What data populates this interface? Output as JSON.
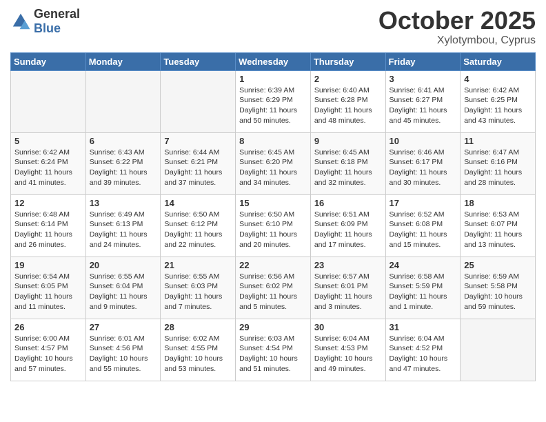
{
  "header": {
    "logo_general": "General",
    "logo_blue": "Blue",
    "month": "October 2025",
    "location": "Xylotymbou, Cyprus"
  },
  "days_of_week": [
    "Sunday",
    "Monday",
    "Tuesday",
    "Wednesday",
    "Thursday",
    "Friday",
    "Saturday"
  ],
  "weeks": [
    [
      {
        "day": "",
        "empty": true
      },
      {
        "day": "",
        "empty": true
      },
      {
        "day": "",
        "empty": true
      },
      {
        "day": "1",
        "sunrise": "Sunrise: 6:39 AM",
        "sunset": "Sunset: 6:29 PM",
        "daylight": "Daylight: 11 hours and 50 minutes."
      },
      {
        "day": "2",
        "sunrise": "Sunrise: 6:40 AM",
        "sunset": "Sunset: 6:28 PM",
        "daylight": "Daylight: 11 hours and 48 minutes."
      },
      {
        "day": "3",
        "sunrise": "Sunrise: 6:41 AM",
        "sunset": "Sunset: 6:27 PM",
        "daylight": "Daylight: 11 hours and 45 minutes."
      },
      {
        "day": "4",
        "sunrise": "Sunrise: 6:42 AM",
        "sunset": "Sunset: 6:25 PM",
        "daylight": "Daylight: 11 hours and 43 minutes."
      }
    ],
    [
      {
        "day": "5",
        "sunrise": "Sunrise: 6:42 AM",
        "sunset": "Sunset: 6:24 PM",
        "daylight": "Daylight: 11 hours and 41 minutes."
      },
      {
        "day": "6",
        "sunrise": "Sunrise: 6:43 AM",
        "sunset": "Sunset: 6:22 PM",
        "daylight": "Daylight: 11 hours and 39 minutes."
      },
      {
        "day": "7",
        "sunrise": "Sunrise: 6:44 AM",
        "sunset": "Sunset: 6:21 PM",
        "daylight": "Daylight: 11 hours and 37 minutes."
      },
      {
        "day": "8",
        "sunrise": "Sunrise: 6:45 AM",
        "sunset": "Sunset: 6:20 PM",
        "daylight": "Daylight: 11 hours and 34 minutes."
      },
      {
        "day": "9",
        "sunrise": "Sunrise: 6:45 AM",
        "sunset": "Sunset: 6:18 PM",
        "daylight": "Daylight: 11 hours and 32 minutes."
      },
      {
        "day": "10",
        "sunrise": "Sunrise: 6:46 AM",
        "sunset": "Sunset: 6:17 PM",
        "daylight": "Daylight: 11 hours and 30 minutes."
      },
      {
        "day": "11",
        "sunrise": "Sunrise: 6:47 AM",
        "sunset": "Sunset: 6:16 PM",
        "daylight": "Daylight: 11 hours and 28 minutes."
      }
    ],
    [
      {
        "day": "12",
        "sunrise": "Sunrise: 6:48 AM",
        "sunset": "Sunset: 6:14 PM",
        "daylight": "Daylight: 11 hours and 26 minutes."
      },
      {
        "day": "13",
        "sunrise": "Sunrise: 6:49 AM",
        "sunset": "Sunset: 6:13 PM",
        "daylight": "Daylight: 11 hours and 24 minutes."
      },
      {
        "day": "14",
        "sunrise": "Sunrise: 6:50 AM",
        "sunset": "Sunset: 6:12 PM",
        "daylight": "Daylight: 11 hours and 22 minutes."
      },
      {
        "day": "15",
        "sunrise": "Sunrise: 6:50 AM",
        "sunset": "Sunset: 6:10 PM",
        "daylight": "Daylight: 11 hours and 20 minutes."
      },
      {
        "day": "16",
        "sunrise": "Sunrise: 6:51 AM",
        "sunset": "Sunset: 6:09 PM",
        "daylight": "Daylight: 11 hours and 17 minutes."
      },
      {
        "day": "17",
        "sunrise": "Sunrise: 6:52 AM",
        "sunset": "Sunset: 6:08 PM",
        "daylight": "Daylight: 11 hours and 15 minutes."
      },
      {
        "day": "18",
        "sunrise": "Sunrise: 6:53 AM",
        "sunset": "Sunset: 6:07 PM",
        "daylight": "Daylight: 11 hours and 13 minutes."
      }
    ],
    [
      {
        "day": "19",
        "sunrise": "Sunrise: 6:54 AM",
        "sunset": "Sunset: 6:05 PM",
        "daylight": "Daylight: 11 hours and 11 minutes."
      },
      {
        "day": "20",
        "sunrise": "Sunrise: 6:55 AM",
        "sunset": "Sunset: 6:04 PM",
        "daylight": "Daylight: 11 hours and 9 minutes."
      },
      {
        "day": "21",
        "sunrise": "Sunrise: 6:55 AM",
        "sunset": "Sunset: 6:03 PM",
        "daylight": "Daylight: 11 hours and 7 minutes."
      },
      {
        "day": "22",
        "sunrise": "Sunrise: 6:56 AM",
        "sunset": "Sunset: 6:02 PM",
        "daylight": "Daylight: 11 hours and 5 minutes."
      },
      {
        "day": "23",
        "sunrise": "Sunrise: 6:57 AM",
        "sunset": "Sunset: 6:01 PM",
        "daylight": "Daylight: 11 hours and 3 minutes."
      },
      {
        "day": "24",
        "sunrise": "Sunrise: 6:58 AM",
        "sunset": "Sunset: 5:59 PM",
        "daylight": "Daylight: 11 hours and 1 minute."
      },
      {
        "day": "25",
        "sunrise": "Sunrise: 6:59 AM",
        "sunset": "Sunset: 5:58 PM",
        "daylight": "Daylight: 10 hours and 59 minutes."
      }
    ],
    [
      {
        "day": "26",
        "sunrise": "Sunrise: 6:00 AM",
        "sunset": "Sunset: 4:57 PM",
        "daylight": "Daylight: 10 hours and 57 minutes."
      },
      {
        "day": "27",
        "sunrise": "Sunrise: 6:01 AM",
        "sunset": "Sunset: 4:56 PM",
        "daylight": "Daylight: 10 hours and 55 minutes."
      },
      {
        "day": "28",
        "sunrise": "Sunrise: 6:02 AM",
        "sunset": "Sunset: 4:55 PM",
        "daylight": "Daylight: 10 hours and 53 minutes."
      },
      {
        "day": "29",
        "sunrise": "Sunrise: 6:03 AM",
        "sunset": "Sunset: 4:54 PM",
        "daylight": "Daylight: 10 hours and 51 minutes."
      },
      {
        "day": "30",
        "sunrise": "Sunrise: 6:04 AM",
        "sunset": "Sunset: 4:53 PM",
        "daylight": "Daylight: 10 hours and 49 minutes."
      },
      {
        "day": "31",
        "sunrise": "Sunrise: 6:04 AM",
        "sunset": "Sunset: 4:52 PM",
        "daylight": "Daylight: 10 hours and 47 minutes."
      },
      {
        "day": "",
        "empty": true
      }
    ]
  ]
}
